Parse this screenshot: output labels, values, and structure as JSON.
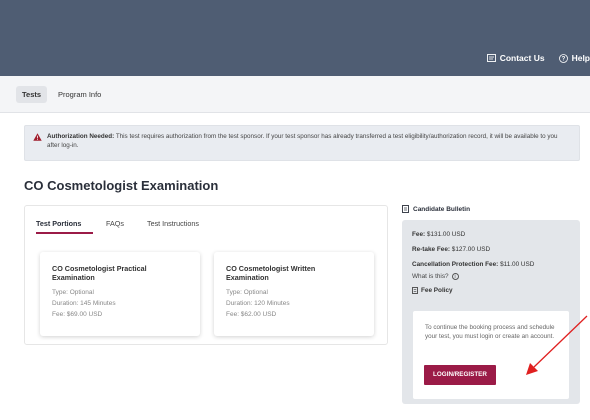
{
  "header": {
    "contact_label": "Contact Us",
    "help_label": "Help"
  },
  "tabs": {
    "tests_label": "Tests",
    "program_info_label": "Program Info"
  },
  "alert": {
    "bold_label": "Authorization Needed:",
    "message": "This test requires authorization from the test sponsor. If your test sponsor has already transferred a test eligibility/authorization record, it will be available to you after log-in."
  },
  "exam": {
    "title": "CO Cosmetologist Examination"
  },
  "panel_tabs": {
    "portions": "Test Portions",
    "faqs": "FAQs",
    "instructions": "Test Instructions"
  },
  "cards": [
    {
      "title": "CO Cosmetologist Practical Examination",
      "type": "Type: Optional",
      "duration": "Duration: 145 Minutes",
      "fee": "Fee: $69.00 USD"
    },
    {
      "title": "CO Cosmetologist Written Examination",
      "type": "Type: Optional",
      "duration": "Duration: 120 Minutes",
      "fee": "Fee: $62.00 USD"
    }
  ],
  "sidebar": {
    "bulletin_label": "Candidate Bulletin",
    "fee_label": "Fee:",
    "fee_value": "$131.00 USD",
    "retake_label": "Re-take Fee:",
    "retake_value": "$127.00 USD",
    "cancel_label": "Cancellation Protection Fee:",
    "cancel_value": "$11.00 USD",
    "what_is_this": "What is this?",
    "fee_policy": "Fee Policy",
    "login_text": "To continue the booking process and schedule your test, you must login or create an account.",
    "login_button": "LOGIN/REGISTER"
  },
  "colors": {
    "header_bg": "#4f5d73",
    "accent": "#9b1b47",
    "arrow": "#e02020"
  }
}
